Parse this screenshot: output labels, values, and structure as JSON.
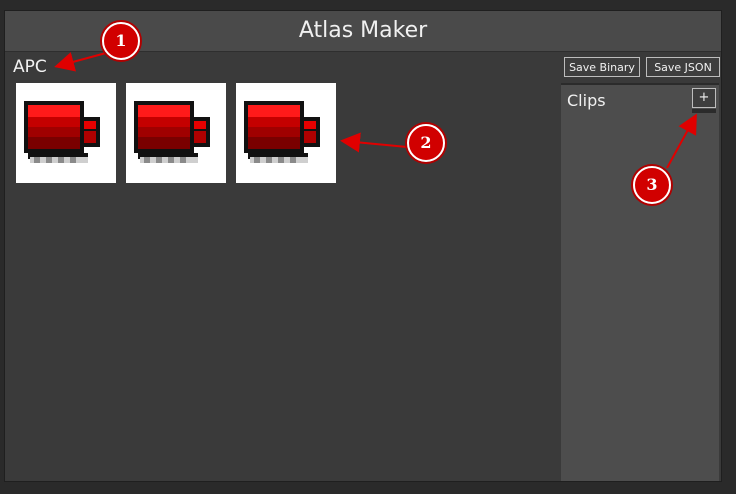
{
  "window": {
    "title": "Atlas Maker"
  },
  "atlas": {
    "name": "APC"
  },
  "toolbar": {
    "save_binary_label": "Save Binary",
    "save_json_label": "Save JSON"
  },
  "sprites": [
    {
      "icon": "apc-sprite"
    },
    {
      "icon": "apc-sprite"
    },
    {
      "icon": "apc-sprite"
    }
  ],
  "clips": {
    "title": "Clips",
    "add_label": "+"
  },
  "annotations": [
    {
      "number": "1"
    },
    {
      "number": "2"
    },
    {
      "number": "3"
    }
  ],
  "colors": {
    "annotation": "#d10000",
    "sprite_red": "#e60000",
    "sprite_dark": "#7a0000"
  }
}
